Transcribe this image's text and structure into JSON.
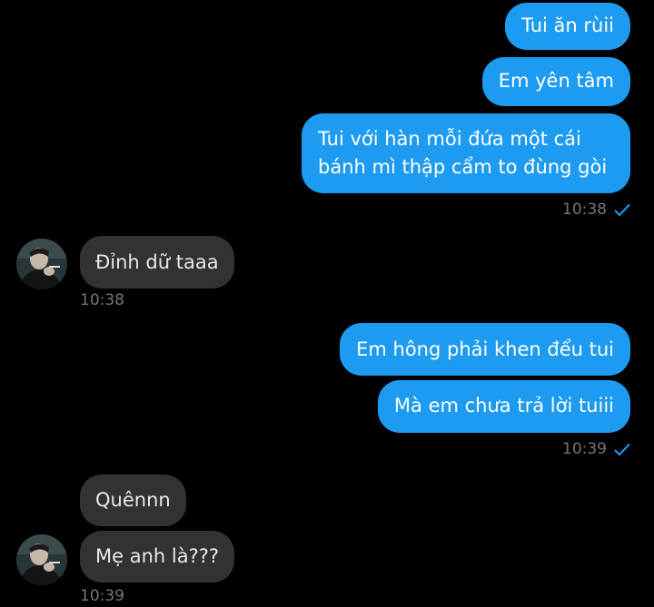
{
  "conversation": {
    "outgoing_1": {
      "messages": [
        "Tui ăn rùii",
        "Em yên tâm"
      ],
      "long_line1": "Tui với hàn mỗi đứa một cái",
      "long_line2": "bánh mì thập cẩm to đùng gòi",
      "timestamp": "10:38",
      "status": "sent"
    },
    "incoming_1": {
      "message": "Đỉnh dữ taaa",
      "timestamp": "10:38"
    },
    "outgoing_2": {
      "messages": [
        "Em hông phải khen đểu tui",
        "Mà em chưa trả lời tuiii"
      ],
      "timestamp": "10:39",
      "status": "sent"
    },
    "incoming_2": {
      "messages": [
        "Quênnn",
        "Mẹ anh là???"
      ],
      "timestamp": "10:39"
    }
  },
  "colors": {
    "background": "#000000",
    "outgoing_bubble": "#1d9bf0",
    "incoming_bubble": "#2f3336",
    "timestamp": "#71767b"
  },
  "icons": {
    "sent_status": "checkmark-icon",
    "avatar": "user-avatar"
  }
}
